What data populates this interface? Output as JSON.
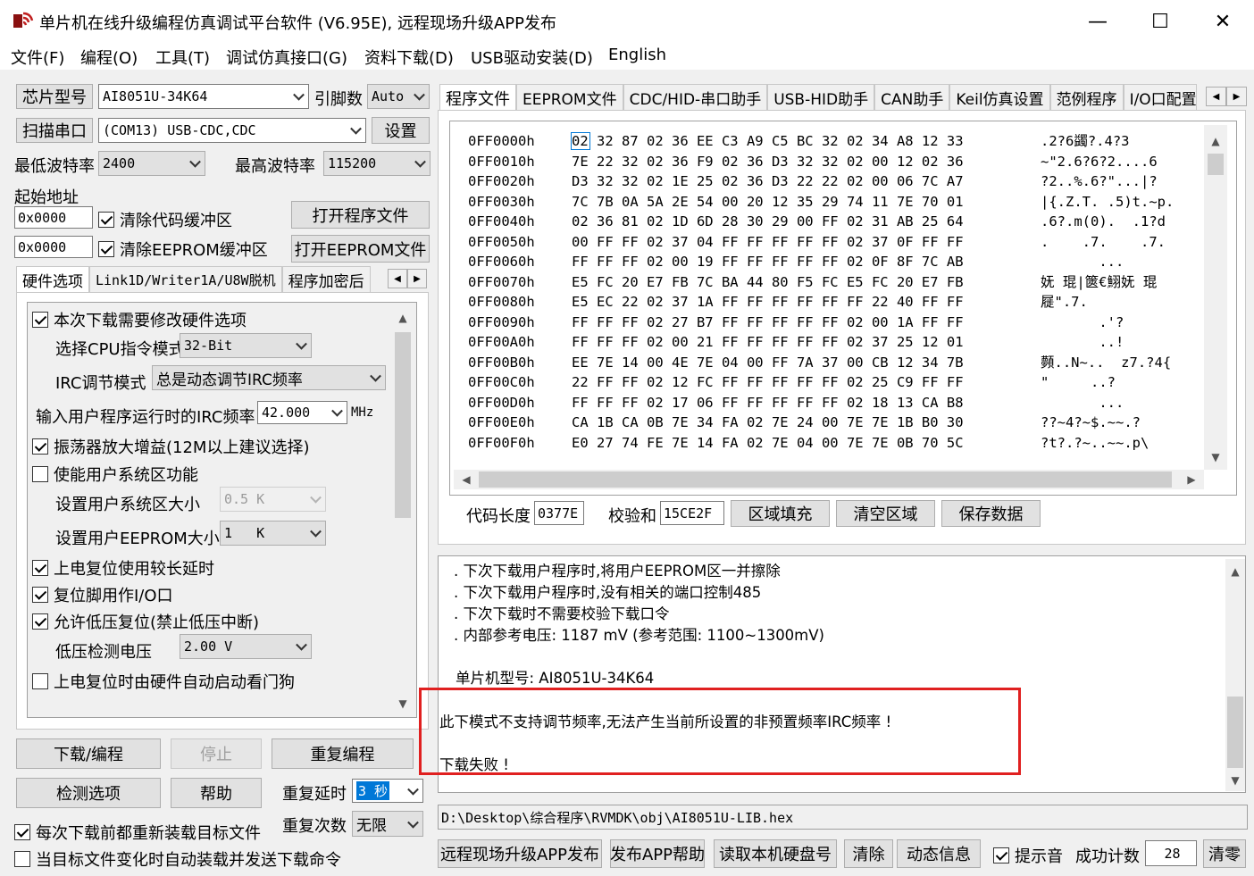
{
  "window": {
    "title": "单片机在线升级编程仿真调试平台软件 (V6.95E), 远程现场升级APP发布",
    "min_glyph": "—",
    "max_glyph": "☐",
    "close_glyph": "✕"
  },
  "menu": [
    "文件(F)",
    "编程(O)",
    "工具(T)",
    "调试仿真接口(G)",
    "资料下载(D)",
    "USB驱动安装(D)",
    "English"
  ],
  "left": {
    "chip_btn": "芯片型号",
    "chip_value": "AI8051U-34K64",
    "pin_label": "引脚数",
    "pin_value": "Auto",
    "scan_btn": "扫描串口",
    "port_value": "(COM13) USB-CDC,CDC",
    "settings_btn": "设置",
    "min_baud_label": "最低波特率",
    "min_baud_value": "2400",
    "max_baud_label": "最高波特率",
    "max_baud_value": "115200",
    "start_addr_label": "起始地址",
    "addr1": "0x0000",
    "clear_code": "清除代码缓冲区",
    "open_prog": "打开程序文件",
    "addr2": "0x0000",
    "clear_eeprom": "清除EEPROM缓冲区",
    "open_eeprom": "打开EEPROM文件",
    "tabs": [
      "硬件选项",
      "Link1D/Writer1A/U8W脱机",
      "程序加密后"
    ],
    "opts": {
      "modify_hw": "本次下载需要修改硬件选项",
      "cpu_mode_label": "选择CPU指令模式",
      "cpu_mode_value": "32-Bit",
      "irc_mode_label": "IRC调节模式",
      "irc_mode_value": "总是动态调节IRC频率",
      "irc_freq_label": "输入用户程序运行时的IRC频率",
      "irc_freq_value": "42.000",
      "irc_freq_unit": "MHz",
      "osc_gain": "振荡器放大增益(12M以上建议选择)",
      "user_sys": "使能用户系统区功能",
      "sys_size_label": "设置用户系统区大小",
      "sys_size_value": "0.5 K",
      "eeprom_size_label": "设置用户EEPROM大小",
      "eeprom_size_value": "1   K",
      "long_delay": "上电复位使用较长延时",
      "reset_io": "复位脚用作I/O口",
      "lvd_reset": "允许低压复位(禁止低压中断)",
      "lvd_label": "低压检测电压",
      "lvd_value": "2.00 V",
      "wdt": "上电复位时由硬件自动启动看门狗"
    },
    "download_btn": "下载/编程",
    "stop_btn": "停止",
    "repeat_btn": "重复编程",
    "detect_btn": "检测选项",
    "help_btn": "帮助",
    "repeat_delay_label": "重复延时",
    "repeat_delay_value": "3 秒",
    "repeat_count_label": "重复次数",
    "repeat_count_value": "无限",
    "reload_chk": "每次下载前都重新装载目标文件",
    "auto_load_chk": "当目标文件变化时自动装载并发送下载命令"
  },
  "right": {
    "tabs": [
      "程序文件",
      "EEPROM文件",
      "CDC/HID-串口助手",
      "USB-HID助手",
      "CAN助手",
      "Keil仿真设置",
      "范例程序",
      "I/O口配置"
    ],
    "hex_rows": [
      {
        "addr": "0FF0000h",
        "bytes": "02 32 87 02 36 EE C3 A9 C5 BC 32 02 34 A8 12 33",
        "ascii": ".2?6蠲?.4?3"
      },
      {
        "addr": "0FF0010h",
        "bytes": "7E 22 32 02 36 F9 02 36 D3 32 32 02 00 12 02 36",
        "ascii": "~\"2.6?6?2....6"
      },
      {
        "addr": "0FF0020h",
        "bytes": "D3 32 32 02 1E 25 02 36 D3 22 22 02 00 06 7C A7",
        "ascii": "?2..%.6?\"...|?"
      },
      {
        "addr": "0FF0030h",
        "bytes": "7C 7B 0A 5A 2E 54 00 20 12 35 29 74 11 7E 70 01",
        "ascii": "|{.Z.T. .5)t.~p."
      },
      {
        "addr": "0FF0040h",
        "bytes": "02 36 81 02 1D 6D 28 30 29 00 FF 02 31 AB 25 64",
        "ascii": ".6?.m(0).  .1?d"
      },
      {
        "addr": "0FF0050h",
        "bytes": "00 FF FF 02 37 04 FF FF FF FF FF 02 37 0F FF FF",
        "ascii": ".    .7.    .7."
      },
      {
        "addr": "0FF0060h",
        "bytes": "FF FF FF 02 00 19 FF FF FF FF FF 02 0F 8F 7C AB",
        "ascii": "       ..."
      },
      {
        "addr": "0FF0070h",
        "bytes": "E5 FC 20 E7 FB 7C BA 44 80 F5 FC E5 FC 20 E7 FB",
        "ascii": "妩 琨|篋€鮙妩 琨"
      },
      {
        "addr": "0FF0080h",
        "bytes": "E5 EC 22 02 37 1A FF FF FF FF FF FF 22 40 FF FF",
        "ascii": "屣\".7."
      },
      {
        "addr": "0FF0090h",
        "bytes": "FF FF FF 02 27 B7 FF FF FF FF FF 02 00 1A FF FF",
        "ascii": "       .'?"
      },
      {
        "addr": "0FF00A0h",
        "bytes": "FF FF FF 02 00 21 FF FF FF FF FF 02 37 25 12 01",
        "ascii": "       ..!"
      },
      {
        "addr": "0FF00B0h",
        "bytes": "EE 7E 14 00 4E 7E 04 00 FF 7A 37 00 CB 12 34 7B",
        "ascii": "顭..N~..  z7.?4{"
      },
      {
        "addr": "0FF00C0h",
        "bytes": "22 FF FF 02 12 FC FF FF FF FF FF 02 25 C9 FF FF",
        "ascii": "\"     ..?"
      },
      {
        "addr": "0FF00D0h",
        "bytes": "FF FF FF 02 17 06 FF FF FF FF FF 02 18 13 CA B8",
        "ascii": "       ..."
      },
      {
        "addr": "0FF00E0h",
        "bytes": "CA 1B CA 0B 7E 34 FA 02 7E 24 00 7E 7E 1B B0 30",
        "ascii": "??~4?~$.~~.?"
      },
      {
        "addr": "0FF00F0h",
        "bytes": "E0 27 74 FE 7E 14 FA 02 7E 04 00 7E 7E 0B 70 5C",
        "ascii": "?t?.?~..~~.p\\"
      }
    ],
    "code_len_label": "代码长度",
    "code_len_value": "0377E",
    "checksum_label": "校验和",
    "checksum_value": "15CE2F",
    "fill_btn": "区域填充",
    "clear_area_btn": "清空区域",
    "save_btn": "保存数据",
    "log_lines": [
      ". 下次下载用户程序时,将用户EEPROM区一并擦除",
      ". 下次下载用户程序时,没有相关的端口控制485",
      ". 下次下载时不需要校验下载口令",
      ". 内部参考电压: 1187 mV (参考范围: 1100~1300mV)"
    ],
    "chip_model_line": "单片机型号: AI8051U-34K64",
    "error_line": "此下模式不支持调节频率,无法产生当前所设置的非预置频率IRC频率 !",
    "fail_line": "下载失败 !",
    "file_path": "D:\\Desktop\\综合程序\\RVMDK\\obj\\AI8051U-LIB.hex",
    "publish_btn": "远程现场升级APP发布",
    "publish_help_btn": "发布APP帮助",
    "read_disk_btn": "读取本机硬盘号",
    "clear_btn": "清除",
    "dynamic_btn": "动态信息",
    "beep_chk": "提示音",
    "success_label": "成功计数",
    "success_value": "28",
    "reset_btn": "清零"
  },
  "colors": {
    "highlight": "#e02020",
    "selection": "#0078d7"
  }
}
